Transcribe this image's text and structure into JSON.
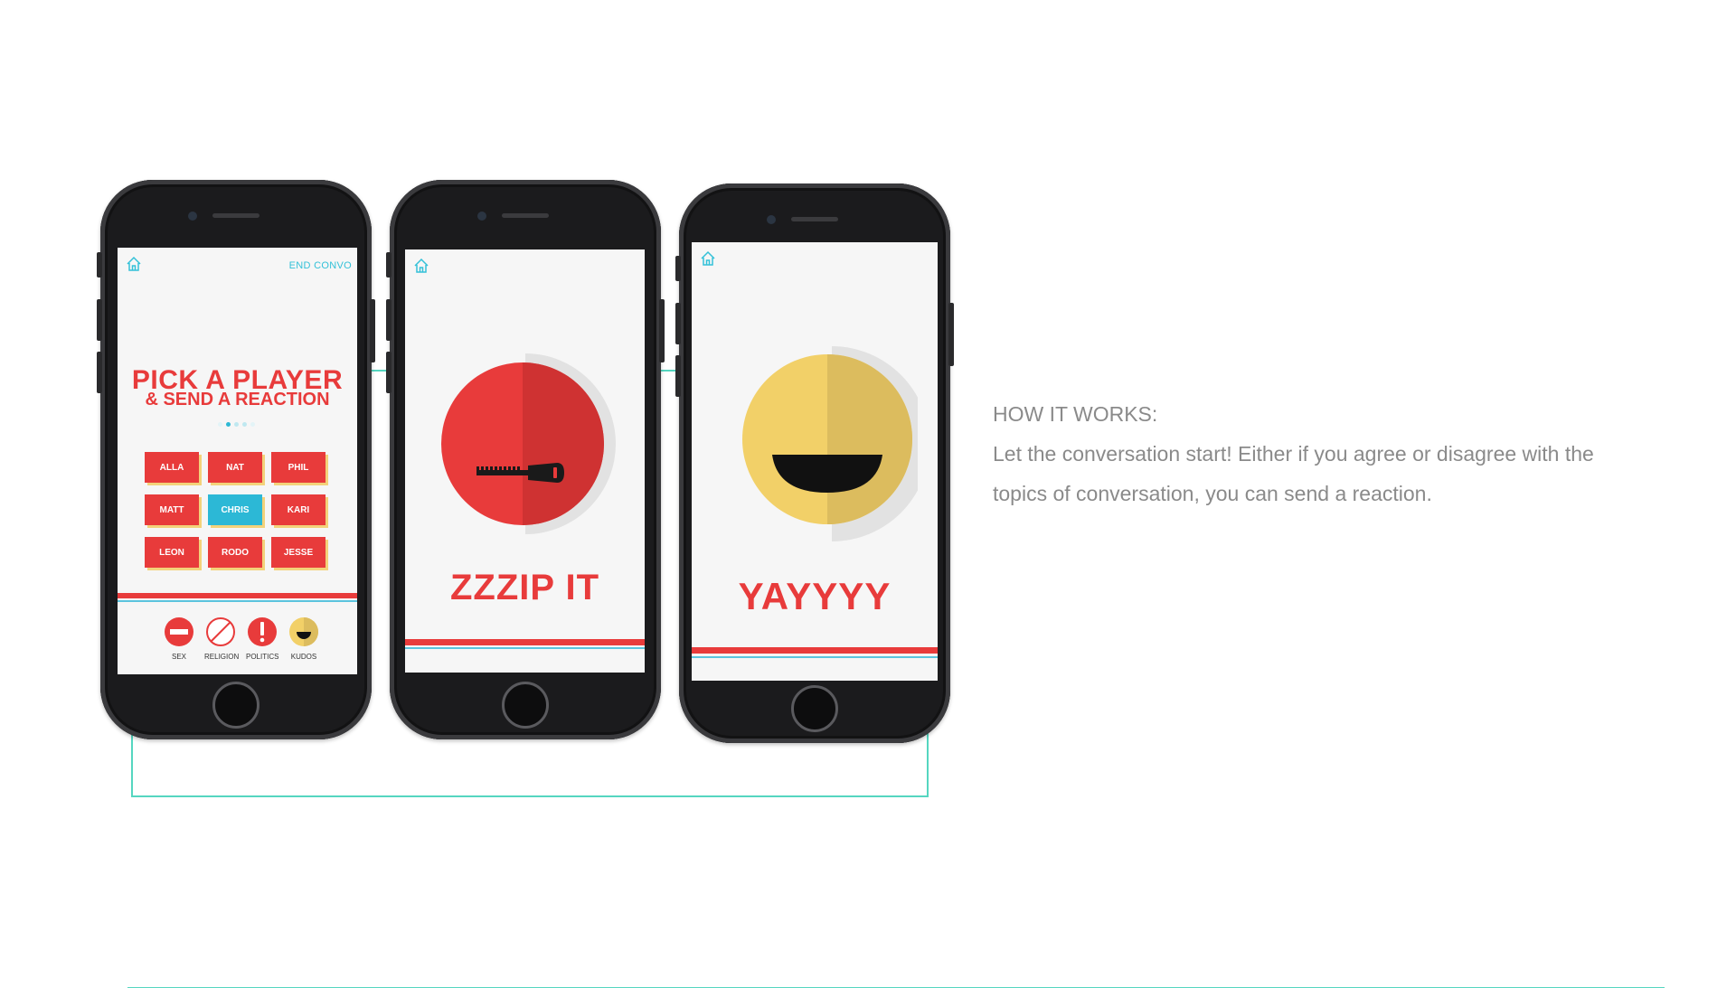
{
  "phone1": {
    "end_convo": "END CONVO",
    "title_line1": "PICK A PLAYER",
    "title_line2": "& SEND A REACTION",
    "players": [
      {
        "name": "ALLA",
        "selected": false
      },
      {
        "name": "NAT",
        "selected": false
      },
      {
        "name": "PHIL",
        "selected": false
      },
      {
        "name": "MATT",
        "selected": false
      },
      {
        "name": "CHRIS",
        "selected": true
      },
      {
        "name": "KARI",
        "selected": false
      },
      {
        "name": "LEON",
        "selected": false
      },
      {
        "name": "RODO",
        "selected": false
      },
      {
        "name": "JESSE",
        "selected": false
      }
    ],
    "reactions": [
      {
        "label": "SEX",
        "icon": "no-entry-icon"
      },
      {
        "label": "RELIGION",
        "icon": "prohibited-icon"
      },
      {
        "label": "POLITICS",
        "icon": "exclamation-icon"
      },
      {
        "label": "KUDOS",
        "icon": "smile-icon"
      }
    ]
  },
  "phone2": {
    "reaction_title": "ZZZIP IT",
    "icon": "zipper-face-icon"
  },
  "phone3": {
    "reaction_title": "YAYYYY",
    "icon": "big-smile-icon"
  },
  "description": {
    "heading": "HOW IT WORKS:",
    "line1": "Let the conversation start! Either if you agree or disagree with the",
    "line2": "topics of conversation, you can send a reaction."
  },
  "colors": {
    "brand_red": "#e83b3b",
    "accent_cyan": "#2cb8d6",
    "connector_teal": "#55d6c0",
    "kudos_yellow": "#f2d068"
  }
}
